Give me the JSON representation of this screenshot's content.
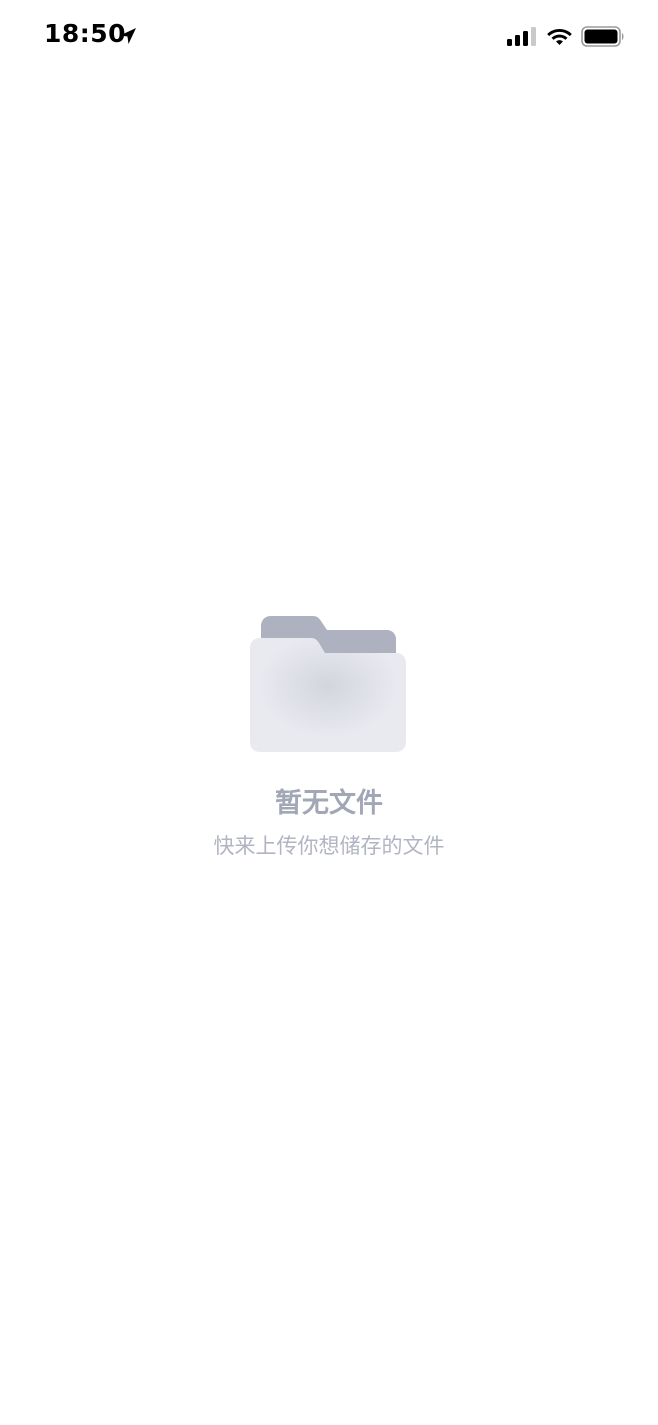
{
  "status_bar": {
    "time": "18:50",
    "icons": [
      "location-arrow-icon",
      "cellular-signal-icon",
      "wifi-icon",
      "battery-icon"
    ]
  },
  "empty_state": {
    "illustration": "folder-icon",
    "title": "暂无文件",
    "subtitle": "快来上传你想储存的文件"
  },
  "colors": {
    "background": "#ffffff",
    "title": "#a2a7b6",
    "subtitle": "#b1b5c3",
    "folder_back": "#aeb2c0",
    "folder_front": "#e8e9ef"
  }
}
